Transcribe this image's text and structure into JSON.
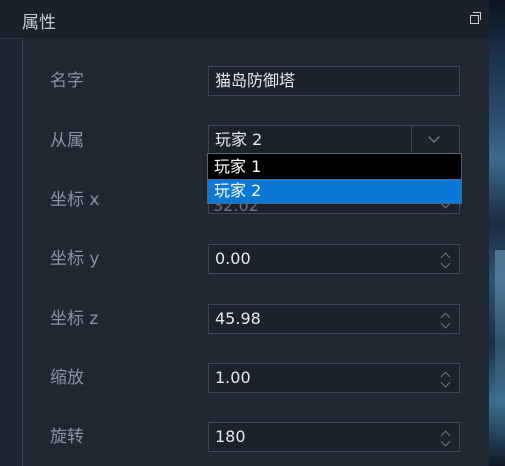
{
  "panel": {
    "title": "属性",
    "restore_icon": "restore-window-icon"
  },
  "fields": {
    "name": {
      "label": "名字",
      "value": "猫岛防御塔"
    },
    "owner": {
      "label": "从属",
      "selected": "玩家 2",
      "options": [
        "玩家 1",
        "玩家 2"
      ]
    },
    "coord_x": {
      "label": "坐标 x",
      "partial_value": "32.02"
    },
    "coord_y": {
      "label": "坐标 y",
      "value": "0.00"
    },
    "coord_z": {
      "label": "坐标 z",
      "value": "45.98"
    },
    "scale": {
      "label": "缩放",
      "value": "1.00"
    },
    "rotation": {
      "label": "旋转",
      "value": "180"
    }
  },
  "colors": {
    "panel_bg": "#1d2530",
    "selection": "#0a78d4",
    "dropdown_bg": "#000000",
    "label_text": "#8a939f",
    "value_text": "#e4e8ee"
  }
}
